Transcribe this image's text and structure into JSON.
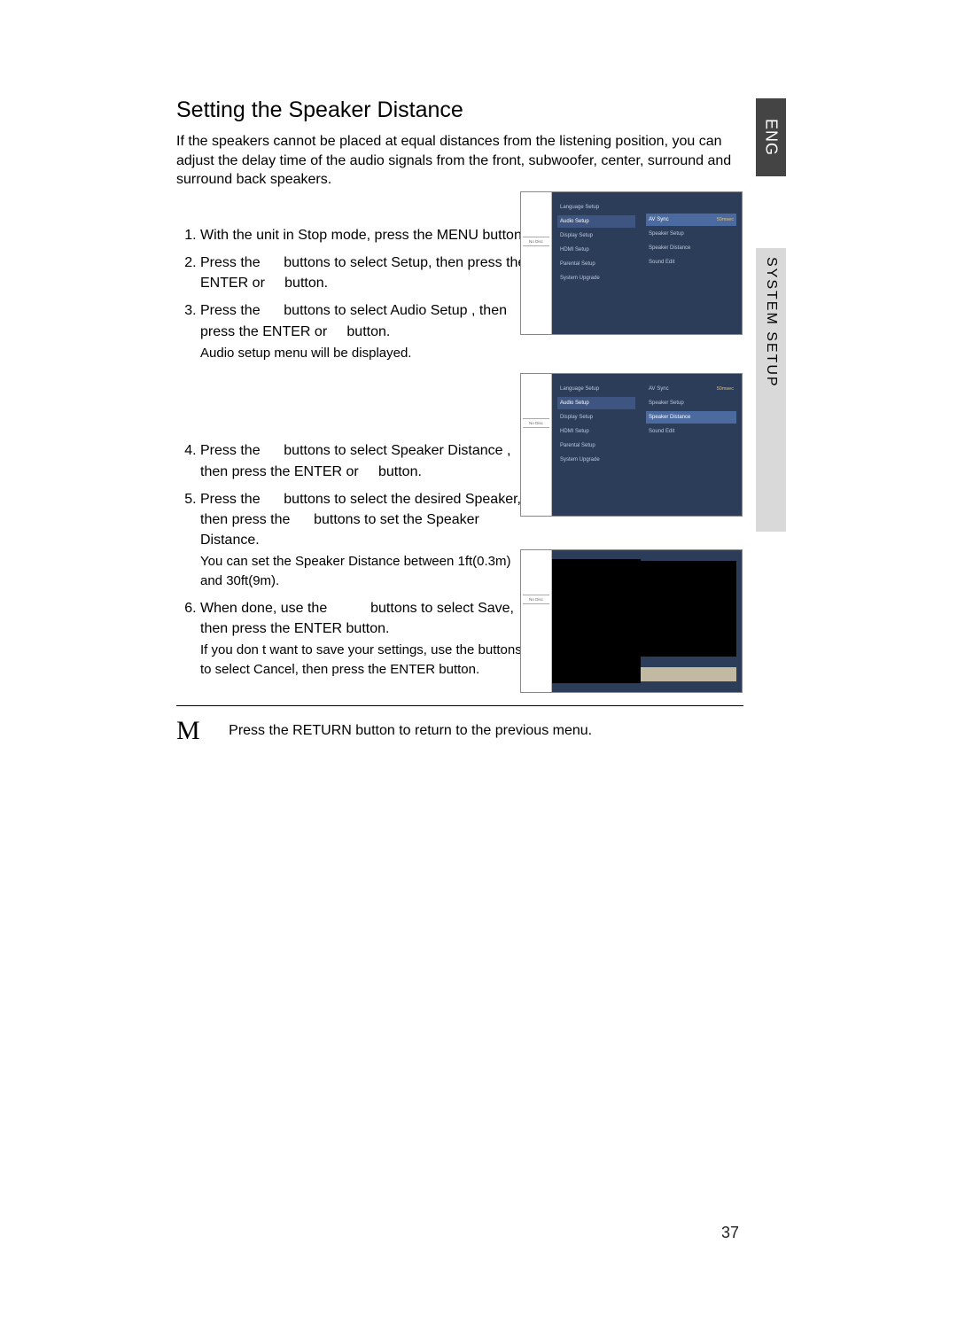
{
  "lang_tab": "ENG",
  "side_label": "SYSTEM SETUP",
  "title": "Setting the Speaker Distance",
  "intro": "If the speakers cannot be placed at equal distances from the listening position, you can adjust the delay time of the audio signals from the front, subwoofer, center, surround and surround back speakers.",
  "steps": {
    "s1": "With the unit in Stop mode, press the MENU button.",
    "s2a": "Press the",
    "s2b": "buttons to select Setup, then press the ENTER or",
    "s2c": "button.",
    "s3a": "Press the",
    "s3b": "buttons to select Audio Setup , then press the ENTER or",
    "s3c": "button.",
    "s3_sub": "Audio setup menu will be displayed.",
    "s4a": "Press the",
    "s4b": "buttons to select Speaker Distance , then press the ENTER or",
    "s4c": "button.",
    "s5a": "Press the",
    "s5b": "buttons to select the desired Speaker, then press the",
    "s5c": "buttons to set the Speaker Distance.",
    "s5_sub": "You can set the Speaker Distance between 1ft(0.3m) and 30ft(9m).",
    "s6a": "When done, use the",
    "s6b": "buttons to select Save, then press the ENTER button.",
    "s6_sub": "If you don t want to save your settings, use the buttons to select Cancel, then press the ENTER button."
  },
  "footer_big": "M",
  "footer_text": "Press the RETURN button to return to the previous menu.",
  "page_number": "37",
  "osd_common": {
    "disc_label": "No Disc",
    "menu_items": [
      "Language Setup",
      "Audio Setup",
      "Display Setup",
      "HDMI Setup",
      "Parental Setup",
      "System Upgrade"
    ]
  },
  "osd1_right": [
    {
      "label": "AV Sync",
      "value": "50msec"
    },
    {
      "label": "Speaker Setup",
      "value": ""
    },
    {
      "label": "Speaker Distance",
      "value": ""
    },
    {
      "label": "Sound Edit",
      "value": ""
    }
  ],
  "osd2_right": [
    {
      "label": "AV Sync",
      "value": "50msec"
    },
    {
      "label": "Speaker Setup",
      "value": ""
    },
    {
      "label": "Speaker Distance",
      "value": ""
    },
    {
      "label": "Sound Edit",
      "value": ""
    }
  ]
}
